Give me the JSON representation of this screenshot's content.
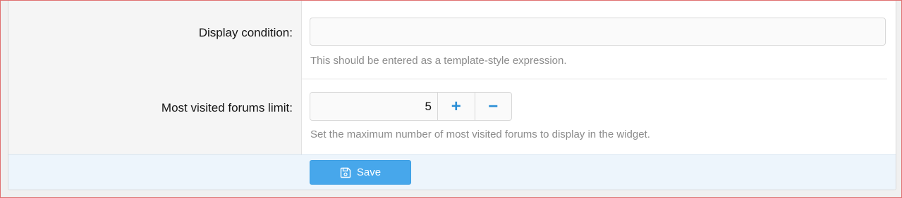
{
  "form": {
    "display_condition": {
      "label": "Display condition:",
      "value": "",
      "hint": "This should be entered as a template-style expression."
    },
    "forums_limit": {
      "label": "Most visited forums limit:",
      "value": "5",
      "increment_label": "+",
      "decrement_label": "−",
      "hint": "Set the maximum number of most visited forums to display in the widget."
    }
  },
  "footer": {
    "save_label": "Save",
    "save_icon": "floppy-disk-icon"
  },
  "colors": {
    "accent": "#47a7eb",
    "footer_bg": "#edf5fc",
    "label_bg": "#f5f5f5"
  }
}
